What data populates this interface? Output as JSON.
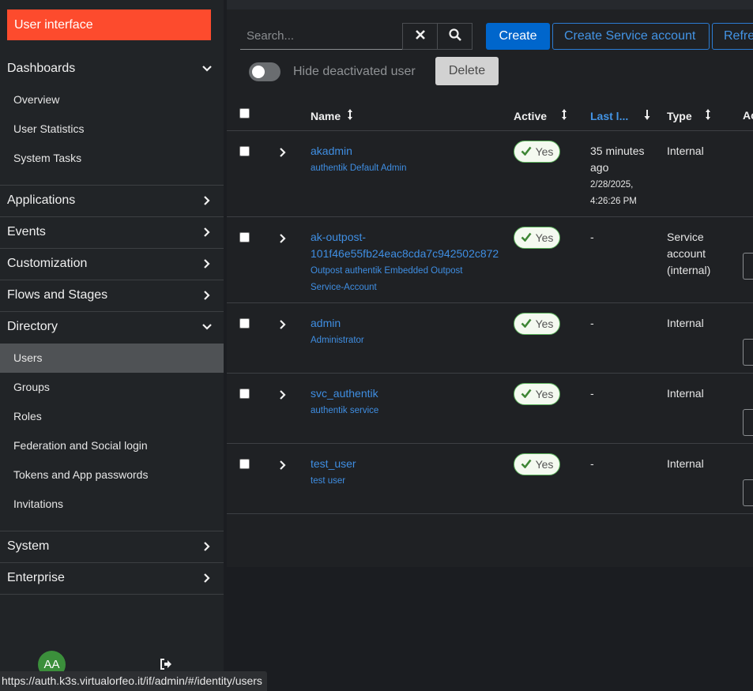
{
  "sidebar": {
    "banner": "User interface",
    "dashboards": {
      "label": "Dashboards",
      "items": [
        "Overview",
        "User Statistics",
        "System Tasks"
      ]
    },
    "sections": [
      "Applications",
      "Events",
      "Customization",
      "Flows and Stages"
    ],
    "directory": {
      "label": "Directory",
      "items": [
        "Users",
        "Groups",
        "Roles",
        "Federation and Social login",
        "Tokens and App passwords",
        "Invitations"
      ]
    },
    "bottom_sections": [
      "System",
      "Enterprise"
    ],
    "avatar_initials": "AA"
  },
  "status_url": "https://auth.k3s.virtualorfeo.it/if/admin/#/identity/users",
  "toolbar": {
    "search_placeholder": "Search...",
    "create_label": "Create",
    "create_service_label": "Create Service account",
    "refresh_label": "Refresh",
    "hide_deactivated_label": "Hide deactivated user",
    "delete_label": "Delete"
  },
  "table": {
    "columns": {
      "name": "Name",
      "active": "Active",
      "last_login": "Last l...",
      "type": "Type",
      "actions": "Ac"
    },
    "rows": [
      {
        "username": "akadmin",
        "description": "authentik Default Admin",
        "active": "Yes",
        "last_login_rel_1": "35 minutes",
        "last_login_rel_2": "ago",
        "last_login_abs_1": "2/28/2025,",
        "last_login_abs_2": "4:26:26 PM",
        "type": "Internal"
      },
      {
        "username_1": "ak-outpost-",
        "username_2": "101f46e55fb24eac8cda7c942502c872",
        "description_1": "Outpost authentik Embedded Outpost",
        "description_2": "Service-Account",
        "active": "Yes",
        "last_login": "-",
        "type_1": "Service",
        "type_2": "account",
        "type_3": "(internal)"
      },
      {
        "username": "admin",
        "description": "Administrator",
        "active": "Yes",
        "last_login": "-",
        "type": "Internal"
      },
      {
        "username": "svc_authentik",
        "description": "authentik service",
        "active": "Yes",
        "last_login": "-",
        "type": "Internal"
      },
      {
        "username": "test_user",
        "description": "test user",
        "active": "Yes",
        "last_login": "-",
        "type": "Internal"
      }
    ]
  },
  "colors": {
    "accent": "#fd4b2d",
    "primary": "#0066cc",
    "link": "#3f8ee2",
    "success": "#3e8635"
  }
}
